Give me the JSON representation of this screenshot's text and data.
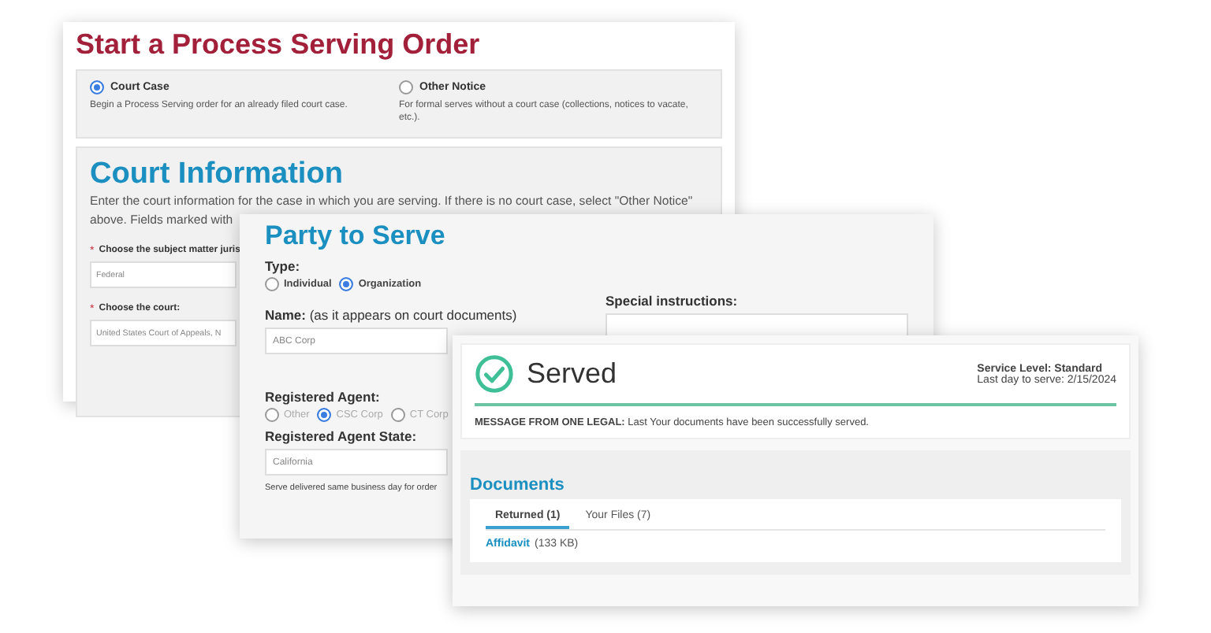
{
  "order_form": {
    "title": "Start a Process Serving Order",
    "case_types": [
      {
        "label": "Court Case",
        "description": "Begin a Process Serving order for an already filed court case.",
        "selected": true
      },
      {
        "label": "Other Notice",
        "description": "For formal serves without a court case (collections, notices to vacate, etc.).",
        "selected": false
      }
    ],
    "court_information": {
      "heading": "Court Information",
      "description_lines": [
        "Enter the court information for the case in which you are serving. If there is no court case, select \"Other Notice\"",
        "above. Fields marked with"
      ],
      "fields": [
        {
          "marker": "*",
          "label": "Choose the subject matter juris",
          "value": "Federal"
        },
        {
          "marker": "*",
          "label": "Choose the court:",
          "value": "United States Court of Appeals, N"
        }
      ]
    }
  },
  "party_form": {
    "heading": "Party to Serve",
    "type_label": "Type:",
    "types": [
      {
        "label": "Individual",
        "selected": false
      },
      {
        "label": "Organization",
        "selected": true
      }
    ],
    "name_label": "**Name:** (as it appears on court documents)",
    "name_value": "ABC Corp",
    "special_instructions_label": "Special instructions:",
    "agent_label": "Registered Agent:",
    "agents": [
      {
        "label": "Other",
        "selected": false
      },
      {
        "label": "CSC Corp",
        "selected": true
      },
      {
        "label": "CT Corp",
        "selected": false
      }
    ],
    "agent_state_label": "Registered Agent State:",
    "agent_state_value": "California",
    "note": "Serve delivered same business day for order"
  },
  "status_card": {
    "status": "Served",
    "service_level": "Service Level: Standard",
    "last_day": "Last day to serve: 2/15/2024",
    "message": "**MESSAGE FROM ONE LEGAL:** Last Your documents have been successfully served.",
    "documents": {
      "heading": "Documents",
      "tabs": [
        {
          "label": "Returned (1)",
          "selected": true
        },
        {
          "label": "Your Files (7)",
          "selected": false
        }
      ],
      "files": [
        {
          "name": "Affidavit",
          "size": "(133 KB)"
        }
      ]
    }
  }
}
